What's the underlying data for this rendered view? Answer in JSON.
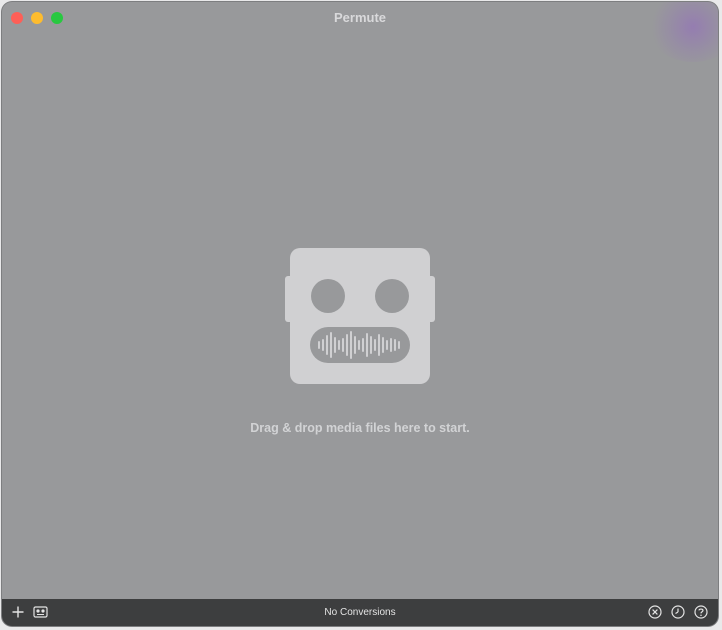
{
  "window": {
    "title": "Permute"
  },
  "main": {
    "drop_prompt": "Drag & drop media files here to start."
  },
  "bottombar": {
    "status": "No Conversions",
    "left_icons": [
      "plus-icon",
      "presets-icon"
    ],
    "right_icons": [
      "cancel-icon",
      "history-icon",
      "help-icon"
    ]
  },
  "colors": {
    "background": "#98999b",
    "robot": "#d0d0d2",
    "bottombar": "#3d3e3f",
    "close": "#fe5f57",
    "minimize": "#febc2e",
    "zoom": "#28c840"
  }
}
